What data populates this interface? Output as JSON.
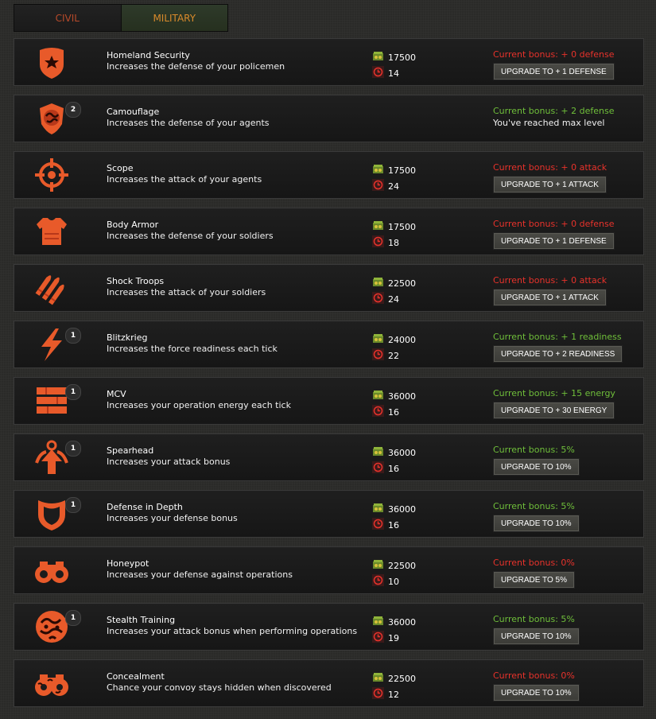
{
  "tabs": [
    {
      "label": "CIVIL"
    },
    {
      "label": "MILITARY"
    }
  ],
  "colors": {
    "accent_orange": "#e85a2a",
    "bonus_red": "#e8322b",
    "bonus_green": "#6fbf3a"
  },
  "upgrades": [
    {
      "icon": "police-badge-icon",
      "name": "Homeland Security",
      "desc": "Increases the defense of your policemen",
      "level": "",
      "cost": "17500",
      "time": "14",
      "bonus": "Current bonus: + 0 defense",
      "bonus_state": "red",
      "button": "UPGRADE TO + 1 DEFENSE",
      "max": ""
    },
    {
      "icon": "camouflage-shield-icon",
      "name": "Camouflage",
      "desc": "Increases the defense of your agents",
      "level": "2",
      "cost": "",
      "time": "",
      "bonus": "Current bonus: + 2 defense",
      "bonus_state": "green",
      "button": "",
      "max": "You've reached max level"
    },
    {
      "icon": "crosshair-icon",
      "name": "Scope",
      "desc": "Increases the attack of your agents",
      "level": "",
      "cost": "17500",
      "time": "24",
      "bonus": "Current bonus: + 0 attack",
      "bonus_state": "red",
      "button": "UPGRADE TO + 1 ATTACK",
      "max": ""
    },
    {
      "icon": "body-armor-icon",
      "name": "Body Armor",
      "desc": "Increases the defense of your soldiers",
      "level": "",
      "cost": "17500",
      "time": "18",
      "bonus": "Current bonus: + 0 defense",
      "bonus_state": "red",
      "button": "UPGRADE TO + 1 DEFENSE",
      "max": ""
    },
    {
      "icon": "bullets-icon",
      "name": "Shock Troops",
      "desc": "Increases the attack of your soldiers",
      "level": "",
      "cost": "22500",
      "time": "24",
      "bonus": "Current bonus: + 0 attack",
      "bonus_state": "red",
      "button": "UPGRADE TO + 1 ATTACK",
      "max": ""
    },
    {
      "icon": "lightning-icon",
      "name": "Blitzkrieg",
      "desc": "Increases the force readiness each tick",
      "level": "1",
      "cost": "24000",
      "time": "22",
      "bonus": "Current bonus: + 1 readiness",
      "bonus_state": "green",
      "button": "UPGRADE TO + 2 READINESS",
      "max": ""
    },
    {
      "icon": "stack-icon",
      "name": "MCV",
      "desc": "Increases your operation energy each tick",
      "level": "1",
      "cost": "36000",
      "time": "16",
      "bonus": "Current bonus: + 15 energy",
      "bonus_state": "green",
      "button": "UPGRADE TO + 30 ENERGY",
      "max": ""
    },
    {
      "icon": "spearhead-arrow-icon",
      "name": "Spearhead",
      "desc": "Increases your attack bonus",
      "level": "1",
      "cost": "36000",
      "time": "16",
      "bonus": "Current bonus: 5%",
      "bonus_state": "green",
      "button": "UPGRADE TO 10%",
      "max": ""
    },
    {
      "icon": "shield-icon",
      "name": "Defense in Depth",
      "desc": "Increases your defense bonus",
      "level": "1",
      "cost": "36000",
      "time": "16",
      "bonus": "Current bonus: 5%",
      "bonus_state": "green",
      "button": "UPGRADE TO 10%",
      "max": ""
    },
    {
      "icon": "binoculars-icon",
      "name": "Honeypot",
      "desc": "Increases your defense against operations",
      "level": "",
      "cost": "22500",
      "time": "10",
      "bonus": "Current bonus: 0%",
      "bonus_state": "red",
      "button": "UPGRADE TO 5%",
      "max": ""
    },
    {
      "icon": "camo-circle-icon",
      "name": "Stealth Training",
      "desc": "Increases your attack bonus when performing operations",
      "level": "1",
      "cost": "36000",
      "time": "19",
      "bonus": "Current bonus: 5%",
      "bonus_state": "green",
      "button": "UPGRADE TO 10%",
      "max": ""
    },
    {
      "icon": "camo-binoculars-icon",
      "name": "Concealment",
      "desc": "Chance your convoy stays hidden when discovered",
      "level": "",
      "cost": "22500",
      "time": "12",
      "bonus": "Current bonus: 0%",
      "bonus_state": "red",
      "button": "UPGRADE TO 10%",
      "max": ""
    }
  ]
}
